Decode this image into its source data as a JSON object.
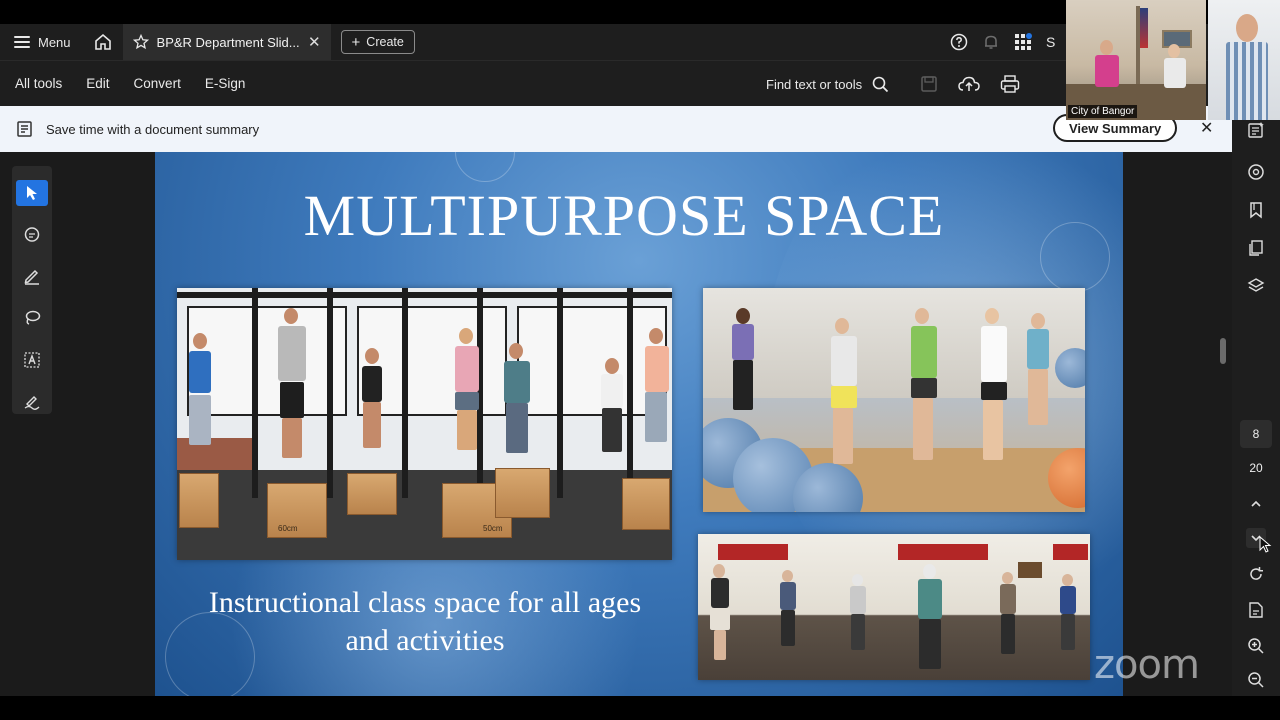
{
  "tabbar": {
    "menu_label": "Menu",
    "tab_title": "BP&R Department Slid...",
    "create_label": "Create",
    "user_initial": "S"
  },
  "toolbar": {
    "items": [
      "All tools",
      "Edit",
      "Convert",
      "E-Sign"
    ],
    "find_label": "Find text or tools"
  },
  "summary_bar": {
    "message": "Save time with a document summary",
    "button_label": "View Summary",
    "close": "✕"
  },
  "slide": {
    "title": "MULTIPURPOSE SPACE",
    "caption": "Instructional class space for all ages and activities",
    "box_labels": [
      "60cm",
      "60cm",
      "50cm"
    ]
  },
  "page_nav": {
    "current_page": "8",
    "total_pages": "20"
  },
  "zoom": {
    "camera_label": "City of Bangor",
    "logo_text": "zoom"
  },
  "colors": {
    "accent": "#2374e1",
    "app_bg": "#1e1e1e",
    "slide_blue": "#3f7bbd"
  }
}
